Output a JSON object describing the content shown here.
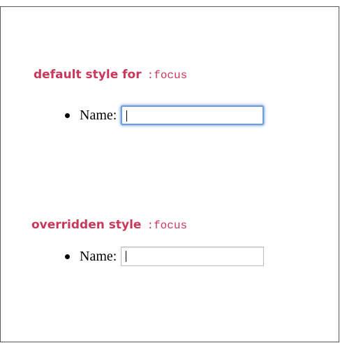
{
  "sections": [
    {
      "heading": "default style for",
      "selector": ":focus",
      "field_label": "Name:",
      "field_value": ""
    },
    {
      "heading": "overridden style",
      "selector": ":focus",
      "field_label": "Name:",
      "field_value": ""
    }
  ],
  "colors": {
    "heading": "#c9385b",
    "focus_ring": "#6e9fd6",
    "plain_border": "#bdbdbd"
  }
}
